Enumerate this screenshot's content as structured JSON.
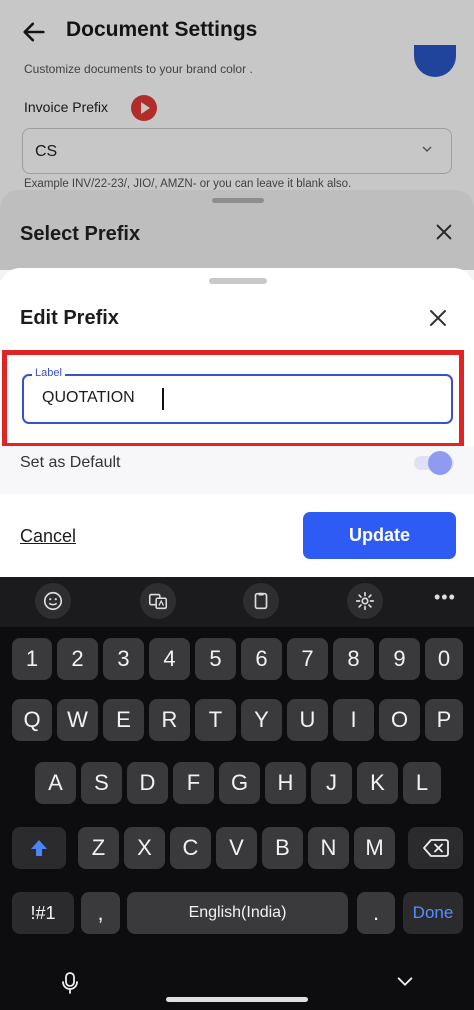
{
  "background": {
    "title": "Document Settings",
    "subtitle": "Customize documents to your brand color .",
    "invoice_prefix_label": "Invoice Prefix",
    "invoice_prefix_value": "CS",
    "example_text": "Example INV/22-23/, JIO/, AMZN- or you can leave it blank also."
  },
  "select_sheet": {
    "title": "Select Prefix"
  },
  "edit_sheet": {
    "title": "Edit Prefix",
    "field_label": "Label",
    "field_value": "QUOTATION",
    "default_label": "Set as Default",
    "default_on": true,
    "cancel_label": "Cancel",
    "update_label": "Update"
  },
  "keyboard": {
    "row_numbers": [
      "1",
      "2",
      "3",
      "4",
      "5",
      "6",
      "7",
      "8",
      "9",
      "0"
    ],
    "row_1": [
      "Q",
      "W",
      "E",
      "R",
      "T",
      "Y",
      "U",
      "I",
      "O",
      "P"
    ],
    "row_2": [
      "A",
      "S",
      "D",
      "F",
      "G",
      "H",
      "J",
      "K",
      "L"
    ],
    "row_3": [
      "Z",
      "X",
      "C",
      "V",
      "B",
      "N",
      "M"
    ],
    "symbols_label": "!#1",
    "comma_label": ",",
    "space_label": "English(India)",
    "period_label": ".",
    "done_label": "Done",
    "toolbar_icons": [
      "emoji-icon",
      "translate-icon",
      "clipboard-icon",
      "settings-icon",
      "more-icon"
    ]
  },
  "colors": {
    "accent": "#2f5bf5",
    "highlight": "#e02424",
    "field_border": "#3b50c9",
    "keyboard_bg": "#0d0d0f"
  }
}
